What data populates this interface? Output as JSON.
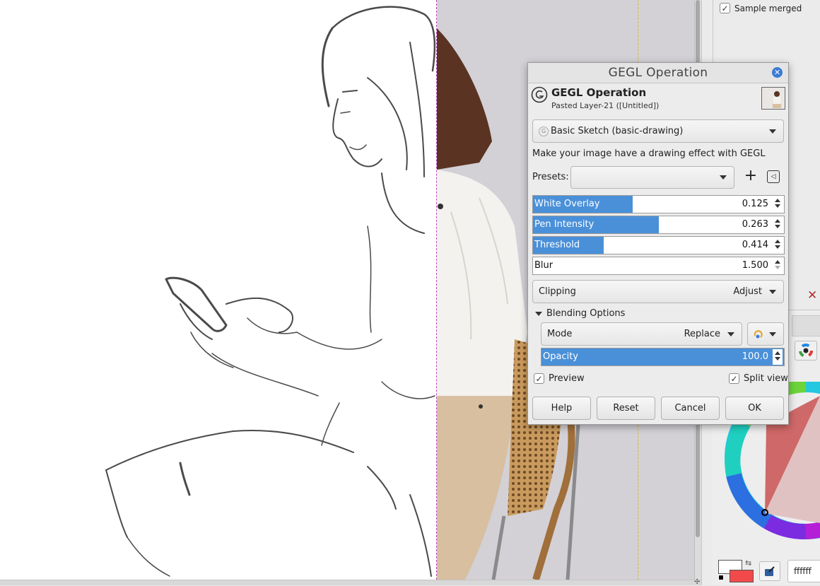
{
  "tool_options": {
    "sample_merged_label": "Sample merged",
    "sample_merged_checked": true
  },
  "dialog": {
    "title": "GEGL Operation",
    "header_title": "GEGL Operation",
    "header_subtitle": "Pasted Layer-21 ([Untitled])",
    "operation": "Basic Sketch (basic-drawing)",
    "description": "Make your image have a drawing effect with GEGL",
    "presets_label": "Presets:",
    "presets_value": "",
    "params": [
      {
        "label": "White Overlay",
        "value": "0.125",
        "fill": 0.4
      },
      {
        "label": "Pen Intensity",
        "value": "0.263",
        "fill": 0.5
      },
      {
        "label": "Threshold",
        "value": "0.414",
        "fill": 0.28
      },
      {
        "label": "Blur",
        "value": "1.500",
        "fill": 0
      }
    ],
    "clipping": {
      "label": "Clipping",
      "value": "Adjust"
    },
    "blending_label": "Blending Options",
    "mode": {
      "label": "Mode",
      "value": "Replace"
    },
    "opacity": {
      "label": "Opacity",
      "value": "100.0",
      "fill": 1.0
    },
    "preview_label": "Preview",
    "preview_checked": true,
    "split_view_label": "Split view",
    "split_view_checked": true,
    "buttons": {
      "help": "Help",
      "reset": "Reset",
      "cancel": "Cancel",
      "ok": "OK"
    }
  },
  "color_panel": {
    "fg_color": "#ffffff",
    "bg_color": "#f24a4a",
    "hex_value": "ffffff"
  },
  "colors": {
    "accent": "#4a90d9",
    "close_button": "#3a7bd5",
    "split_guide": "#c040c0",
    "layer_boundary": "#d8c000"
  },
  "icons": [
    "gegl-icon",
    "close-icon",
    "add-preset-icon",
    "preset-menu-icon",
    "chevron-down-icon",
    "composite-mode-icon",
    "color-wheel-icon",
    "eyedropper-icon",
    "swap-colors-icon",
    "dock-close-icon"
  ]
}
